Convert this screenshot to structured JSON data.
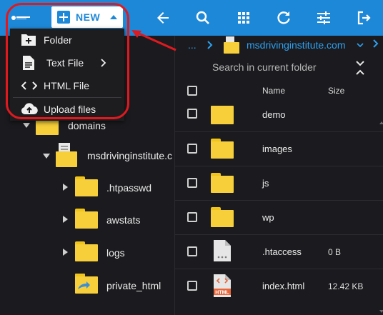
{
  "toolbar": {
    "new_label": "NEW",
    "icons": [
      "back-arrow-icon",
      "search-icon",
      "grid-view-icon",
      "refresh-icon",
      "settings-sliders-icon",
      "logout-icon"
    ]
  },
  "new_menu": {
    "items": [
      {
        "label": "Folder",
        "icon": "new-folder-icon"
      },
      {
        "label": "Text File",
        "icon": "text-file-icon",
        "has_submenu": true
      },
      {
        "label": "HTML File",
        "icon": "code-icon"
      },
      {
        "label": "Upload files",
        "icon": "cloud-upload-icon"
      }
    ]
  },
  "tree": {
    "domains_label": "domains",
    "site_label": "msdrivinginstitute.c",
    "children": [
      {
        "label": ".htpasswd"
      },
      {
        "label": "awstats"
      },
      {
        "label": "logs"
      },
      {
        "label": "private_html"
      }
    ]
  },
  "breadcrumb": {
    "ellipsis": "...",
    "current": "msdrivinginstitute.com"
  },
  "search": {
    "placeholder": "Search in current folder"
  },
  "table": {
    "headers": {
      "name": "Name",
      "size": "Size"
    },
    "rows": [
      {
        "name": "demo",
        "size": "",
        "type": "folder"
      },
      {
        "name": "images",
        "size": "",
        "type": "folder"
      },
      {
        "name": "js",
        "size": "",
        "type": "folder"
      },
      {
        "name": "wp",
        "size": "",
        "type": "folder"
      },
      {
        "name": ".htaccess",
        "size": "0 B",
        "type": "file"
      },
      {
        "name": "index.html",
        "size": "12.42 KB",
        "type": "html"
      }
    ]
  },
  "colors": {
    "topbar": "#1e88d8",
    "accent_link": "#2ca0f0",
    "folder": "#f6cf3a",
    "highlight": "#e0191f"
  }
}
